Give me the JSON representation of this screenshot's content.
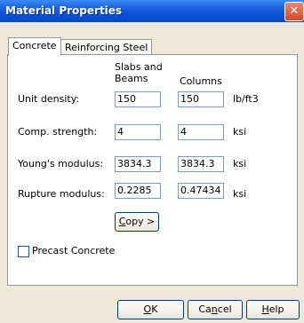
{
  "window": {
    "title": "Material Properties",
    "close_icon": "close-icon"
  },
  "tabs": [
    {
      "label": "Concrete",
      "active": true
    },
    {
      "label": "Reinforcing Steel",
      "active": false
    }
  ],
  "columns": {
    "slabs_beams_line1": "Slabs and",
    "slabs_beams_line2": "Beams",
    "columns": "Columns"
  },
  "rows": [
    {
      "label": "Unit density:",
      "slabs": "150",
      "columns": "150",
      "unit": "lb/ft3"
    },
    {
      "label": "Comp. strength:",
      "slabs": "4",
      "columns": "4",
      "unit": "ksi"
    },
    {
      "label": "Young's modulus:",
      "slabs": "3834.3",
      "columns": "3834.3",
      "unit": "ksi"
    },
    {
      "label": "Rupture modulus:",
      "slabs": "0.2285",
      "columns": "0.47434",
      "unit": "ksi"
    }
  ],
  "copy_button": {
    "label_u": "C",
    "label_rest": "opy >"
  },
  "precast": {
    "label": "Precast Concrete",
    "checked": false
  },
  "buttons": {
    "ok": {
      "u": "O",
      "rest": "K"
    },
    "cancel": {
      "pre": "Ca",
      "u": "n",
      "post": "cel"
    },
    "help": {
      "u": "H",
      "rest": "elp"
    }
  }
}
